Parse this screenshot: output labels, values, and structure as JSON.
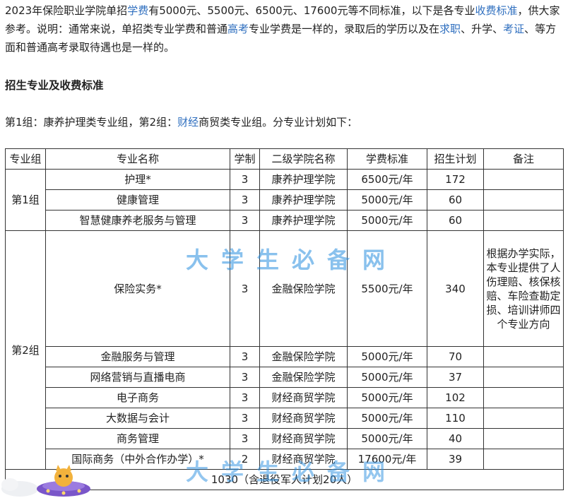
{
  "intro": {
    "s1": "2023年保险职业学院单招",
    "l1": "学费",
    "s2": "有5000元、5500元、6500元、17600元等不同标准，以下是各专业",
    "l2": "收费标准",
    "s3": "，供大家参考。说明：通常来说，单招类专业学费和普通",
    "l3": "高考",
    "s4": "专业学费是一样的，录取后的学历以及在",
    "l4": "求职",
    "s5": "、升学、",
    "l5": "考证",
    "s6": "、等方面和普通高考录取待遇也是一样的。"
  },
  "section_title": "招生专业及收费标准",
  "groups_line": {
    "s1": "第1组：康养护理类专业组，第2组：",
    "l1": "财经",
    "s2": "商贸类专业组。分专业计划如下："
  },
  "table": {
    "headers": [
      "专业组",
      "专业名称",
      "学制",
      "二级学院名称",
      "学费标准",
      "招生计划",
      "备注"
    ],
    "group1": "第1组",
    "group2": "第2组",
    "rows": [
      {
        "major": "护理*",
        "years": "3",
        "college": "康养护理学院",
        "fee": "6500元/年",
        "plan": "172"
      },
      {
        "major": "健康管理",
        "years": "3",
        "college": "康养护理学院",
        "fee": "5000元/年",
        "plan": "60"
      },
      {
        "major": "智慧健康养老服务与管理",
        "years": "3",
        "college": "康养护理学院",
        "fee": "5000元/年",
        "plan": "60"
      },
      {
        "major": "保险实务*",
        "years": "3",
        "college": "金融保险学院",
        "fee": "5500元/年",
        "plan": "340"
      },
      {
        "major": "金融服务与管理",
        "years": "3",
        "college": "金融保险学院",
        "fee": "5000元/年",
        "plan": "70"
      },
      {
        "major": "网络营销与直播电商",
        "years": "3",
        "college": "金融保险学院",
        "fee": "5000元/年",
        "plan": "37"
      },
      {
        "major": "电子商务",
        "years": "3",
        "college": "财经商贸学院",
        "fee": "5000元/年",
        "plan": "102"
      },
      {
        "major": "大数据与会计",
        "years": "3",
        "college": "财经商贸学院",
        "fee": "5000元/年",
        "plan": "110"
      },
      {
        "major": "商务管理",
        "years": "3",
        "college": "财经商贸学院",
        "fee": "5000元/年",
        "plan": "40"
      },
      {
        "major": "国际商务（中外合作办学）*",
        "years": "2",
        "college": "财经商贸学院",
        "fee": "17600元/年",
        "plan": "39"
      }
    ],
    "note_insurance": "根据办学实际，本专业提供了人伤理赔、核保核赔、车险查勘定损、培训讲师四个专业方向",
    "total": "1030（含退役军人计划20人）"
  },
  "watermark": "大学生必备网",
  "colors": {
    "link": "#2f6fbf",
    "watermark": "#2a8fe0",
    "border": "#333333"
  },
  "icons": [
    "ufo-cat-mascot-icon"
  ]
}
